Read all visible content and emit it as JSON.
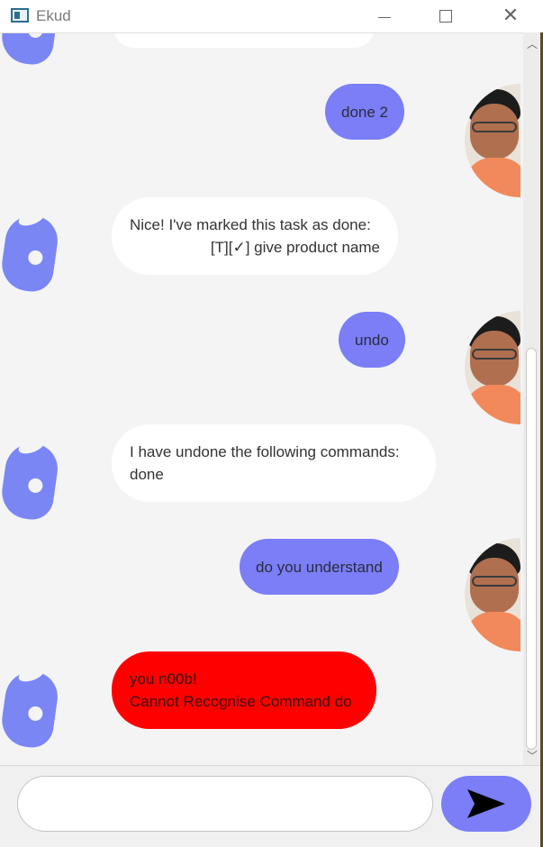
{
  "window": {
    "title": "Ekud"
  },
  "messages": [
    {
      "sender": "user",
      "text": "done 2"
    },
    {
      "sender": "bot",
      "lines": [
        "Nice! I've marked this task as done:",
        "[T][✓] give product name"
      ]
    },
    {
      "sender": "user",
      "text": "undo"
    },
    {
      "sender": "bot",
      "lines": [
        "I have undone the following commands:",
        "done"
      ]
    },
    {
      "sender": "user",
      "text": "do you understand"
    },
    {
      "sender": "bot_error",
      "lines": [
        "you n00b!",
        "Cannot Recognise Command do"
      ]
    }
  ],
  "input": {
    "value": "",
    "placeholder": ""
  },
  "icons": {
    "send": "send-arrow-icon",
    "bot_avatar": "bot-avatar-icon",
    "user_avatar": "user-photo"
  },
  "colors": {
    "user_bubble": "#7b7ef7",
    "bot_bubble": "#ffffff",
    "error_bubble": "#ff0000",
    "chat_background": "#f4f4f4",
    "send_button": "#7b7ef7"
  }
}
